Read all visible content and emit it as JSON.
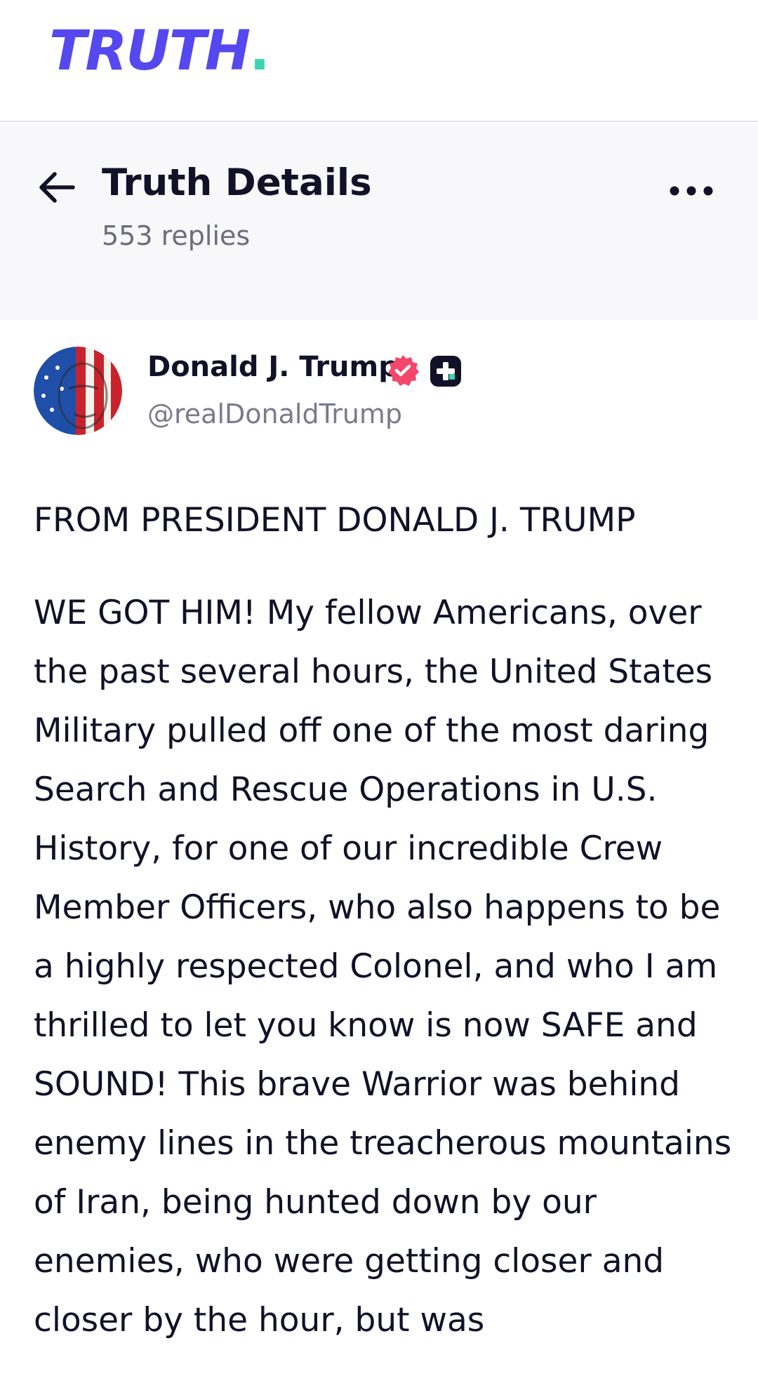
{
  "app": {
    "logo_text": "TRUTH",
    "logo_dot": ".",
    "brand_color": "#5448ee",
    "accent_color": "#3bd4ae"
  },
  "header": {
    "title": "Truth Details",
    "reply_count": "553 replies",
    "back_icon": "arrow-left-icon",
    "more_icon": "more-horizontal-icon"
  },
  "post": {
    "display_name": "Donald J. Trump",
    "handle": "@realDonaldTrump",
    "verified_icon": "verified-badge-icon",
    "plus_icon": "truth-plus-badge-icon",
    "verified_color": "#f4476b",
    "paragraphs": [
      "FROM PRESIDENT DONALD J. TRUMP",
      "WE GOT HIM! My fellow Americans, over the past several hours, the United States Military pulled off one of the most daring Search and Rescue Operations in U.S. History, for one of our incredible Crew Member Officers, who also happens to be a highly respected Colonel, and who I am thrilled to let you know is now SAFE and SOUND! This brave Warrior was behind enemy lines in the treacherous mountains of Iran, being hunted down by our enemies, who were getting closer and closer by the hour, but was"
    ]
  }
}
